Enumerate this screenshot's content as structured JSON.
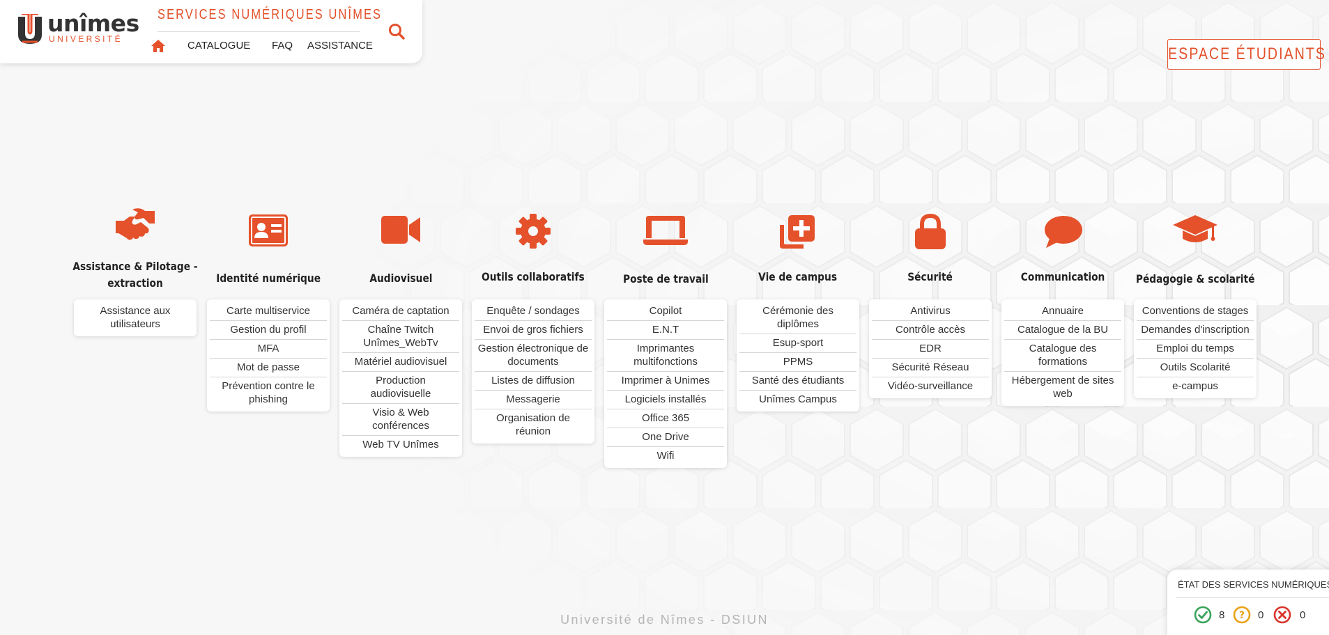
{
  "header": {
    "logo": {
      "name": "unîmes",
      "sub": "UNIVERSITÉ"
    },
    "site_title": "SERVICES NUMÉRIQUES UNÎMES",
    "nav": [
      {
        "label": "CATALOGUE"
      },
      {
        "label": "FAQ"
      },
      {
        "label": "ASSISTANCE"
      }
    ],
    "home_icon": "home-icon",
    "search_icon": "search-icon"
  },
  "student_space": {
    "label": "ESPACE ÉTUDIANTS"
  },
  "categories": [
    {
      "title": "Assistance & Pilotage - extraction",
      "icon": "handshake-icon",
      "links": [
        "Assistance aux utilisateurs"
      ]
    },
    {
      "title": "Identité numérique",
      "icon": "id-card-icon",
      "links": [
        "Carte multiservice",
        "Gestion du profil",
        "MFA",
        "Mot de passe",
        "Prévention contre le phishing"
      ]
    },
    {
      "title": "Audiovisuel",
      "icon": "video-camera-icon",
      "links": [
        "Caméra de captation",
        "Chaîne Twitch Unîmes_WebTv",
        "Matériel audiovisuel",
        "Production audiovisuelle",
        "Visio & Web conférences",
        "Web TV Unîmes"
      ]
    },
    {
      "title": "Outils collaboratifs",
      "icon": "gear-icon",
      "links": [
        "Enquête / sondages",
        "Envoi de gros fichiers",
        "Gestion électronique de documents",
        "Listes de diffusion",
        "Messagerie",
        "Organisation de réunion"
      ]
    },
    {
      "title": "Poste de travail",
      "icon": "laptop-icon",
      "links": [
        "Copilot",
        "E.N.T",
        "Imprimantes multifonctions",
        "Imprimer à Unimes",
        "Logiciels installés",
        "Office 365",
        "One Drive",
        "Wifi"
      ]
    },
    {
      "title": "Vie de campus",
      "icon": "add-square-icon",
      "links": [
        "Cérémonie des diplômes",
        "Esup-sport",
        "PPMS",
        "Santé des étudiants",
        "Unîmes Campus"
      ]
    },
    {
      "title": "Sécurité",
      "icon": "lock-icon",
      "links": [
        "Antivirus",
        "Contrôle accès",
        "EDR",
        "Sécurité Réseau",
        "Vidéo-surveillance"
      ]
    },
    {
      "title": "Communication",
      "icon": "speech-bubble-icon",
      "links": [
        "Annuaire",
        "Catalogue de la BU",
        "Catalogue des formations",
        "Hébergement de sites web"
      ]
    },
    {
      "title": "Pédagogie & scolarité",
      "icon": "graduation-cap-icon",
      "links": [
        "Conventions de stages",
        "Demandes d'inscription",
        "Emploi du temps",
        "Outils Scolarité",
        "e-campus"
      ]
    }
  ],
  "footer": "Université de Nîmes - DSIUN",
  "status": {
    "title": "ÉTAT DES SERVICES NUMÉRIQUES",
    "ok": "8",
    "warning": "0",
    "error": "0"
  },
  "colors": {
    "accent": "#e4512b",
    "ok": "#3aa35a",
    "warning": "#e8a317",
    "error": "#d9342b"
  }
}
